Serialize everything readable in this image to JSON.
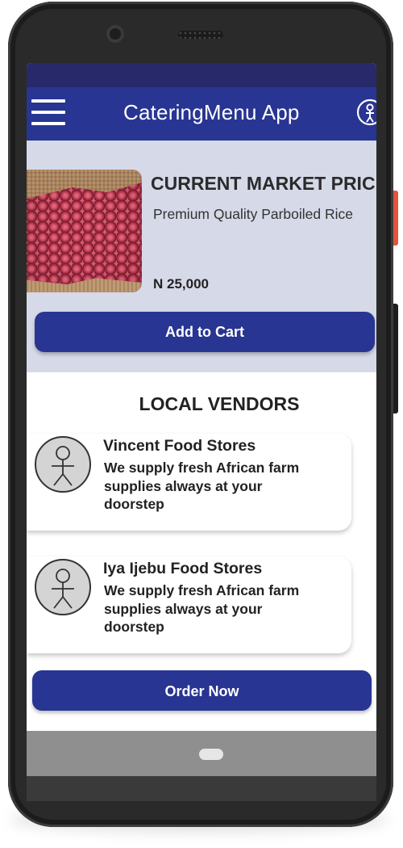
{
  "app": {
    "title": "CateringMenu App"
  },
  "product": {
    "heading": "CURRENT MARKET PRICE",
    "description": "Premium Quality Parboiled Rice",
    "price": "N 25,000",
    "add_to_cart_label": "Add to Cart"
  },
  "vendors": {
    "heading": "LOCAL VENDORS",
    "items": [
      {
        "name": "Vincent Food Stores",
        "description": "We supply fresh African farm supplies always at your doorstep"
      },
      {
        "name": "Iya Ijebu Food Stores",
        "description": "We supply fresh African farm supplies always at your doorstep"
      }
    ],
    "order_now_label": "Order Now"
  },
  "icons": {
    "menu": "hamburger-menu-icon",
    "profile": "person-circle-icon",
    "vendor_avatar": "stick-figure-avatar-icon",
    "home": "home-pill-icon"
  },
  "colors": {
    "primary": "#283592",
    "statusbar": "#28296a",
    "product_background": "#d6d9e8"
  }
}
